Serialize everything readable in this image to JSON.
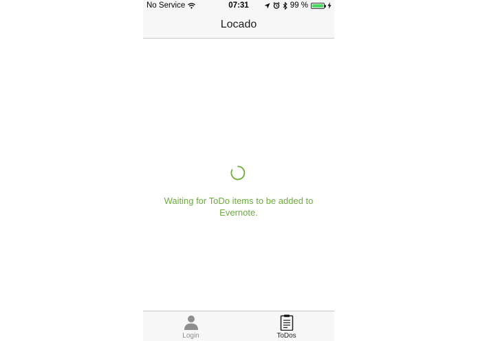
{
  "status_bar": {
    "carrier": "No Service",
    "time": "07:31",
    "battery_percent": "99 %",
    "battery_level": 0.99,
    "battery_color": "#4cd964"
  },
  "nav": {
    "title": "Locado"
  },
  "main": {
    "spinner_icon": "loading-spinner-icon",
    "waiting_message": "Waiting for ToDo items to be added to Evernote.",
    "accent_color": "#6aad38"
  },
  "tab_bar": {
    "tabs": [
      {
        "label": "Login",
        "icon": "person-icon",
        "active": false
      },
      {
        "label": "ToDos",
        "icon": "clipboard-icon",
        "active": true
      }
    ]
  }
}
